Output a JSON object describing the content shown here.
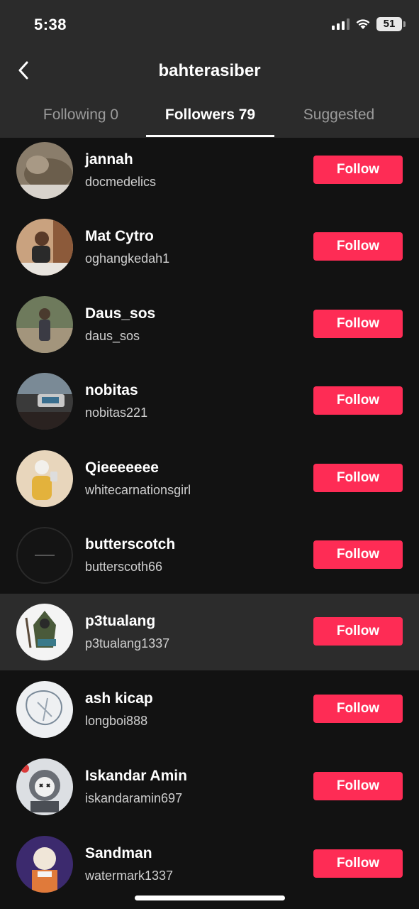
{
  "status_bar": {
    "time": "5:38",
    "battery": "51"
  },
  "header": {
    "title": "bahterasiber"
  },
  "tabs": [
    {
      "label": "Following 0"
    },
    {
      "label": "Followers 79"
    },
    {
      "label": "Suggested"
    }
  ],
  "follow_label": "Follow",
  "followers": [
    {
      "name": "jannah",
      "handle": "docmedelics"
    },
    {
      "name": "Mat Cytro",
      "handle": "oghangkedah1"
    },
    {
      "name": "Daus_sos",
      "handle": "daus_sos"
    },
    {
      "name": "nobitas",
      "handle": "nobitas221"
    },
    {
      "name": "Qieeeeeee",
      "handle": "whitecarnationsgirl"
    },
    {
      "name": "butterscotch",
      "handle": "butterscoth66"
    },
    {
      "name": "p3tualang",
      "handle": "p3tualang1337"
    },
    {
      "name": "ash kicap",
      "handle": "longboi888"
    },
    {
      "name": "Iskandar Amin",
      "handle": "iskandaramin697"
    },
    {
      "name": "Sandman",
      "handle": "watermark1337"
    }
  ]
}
